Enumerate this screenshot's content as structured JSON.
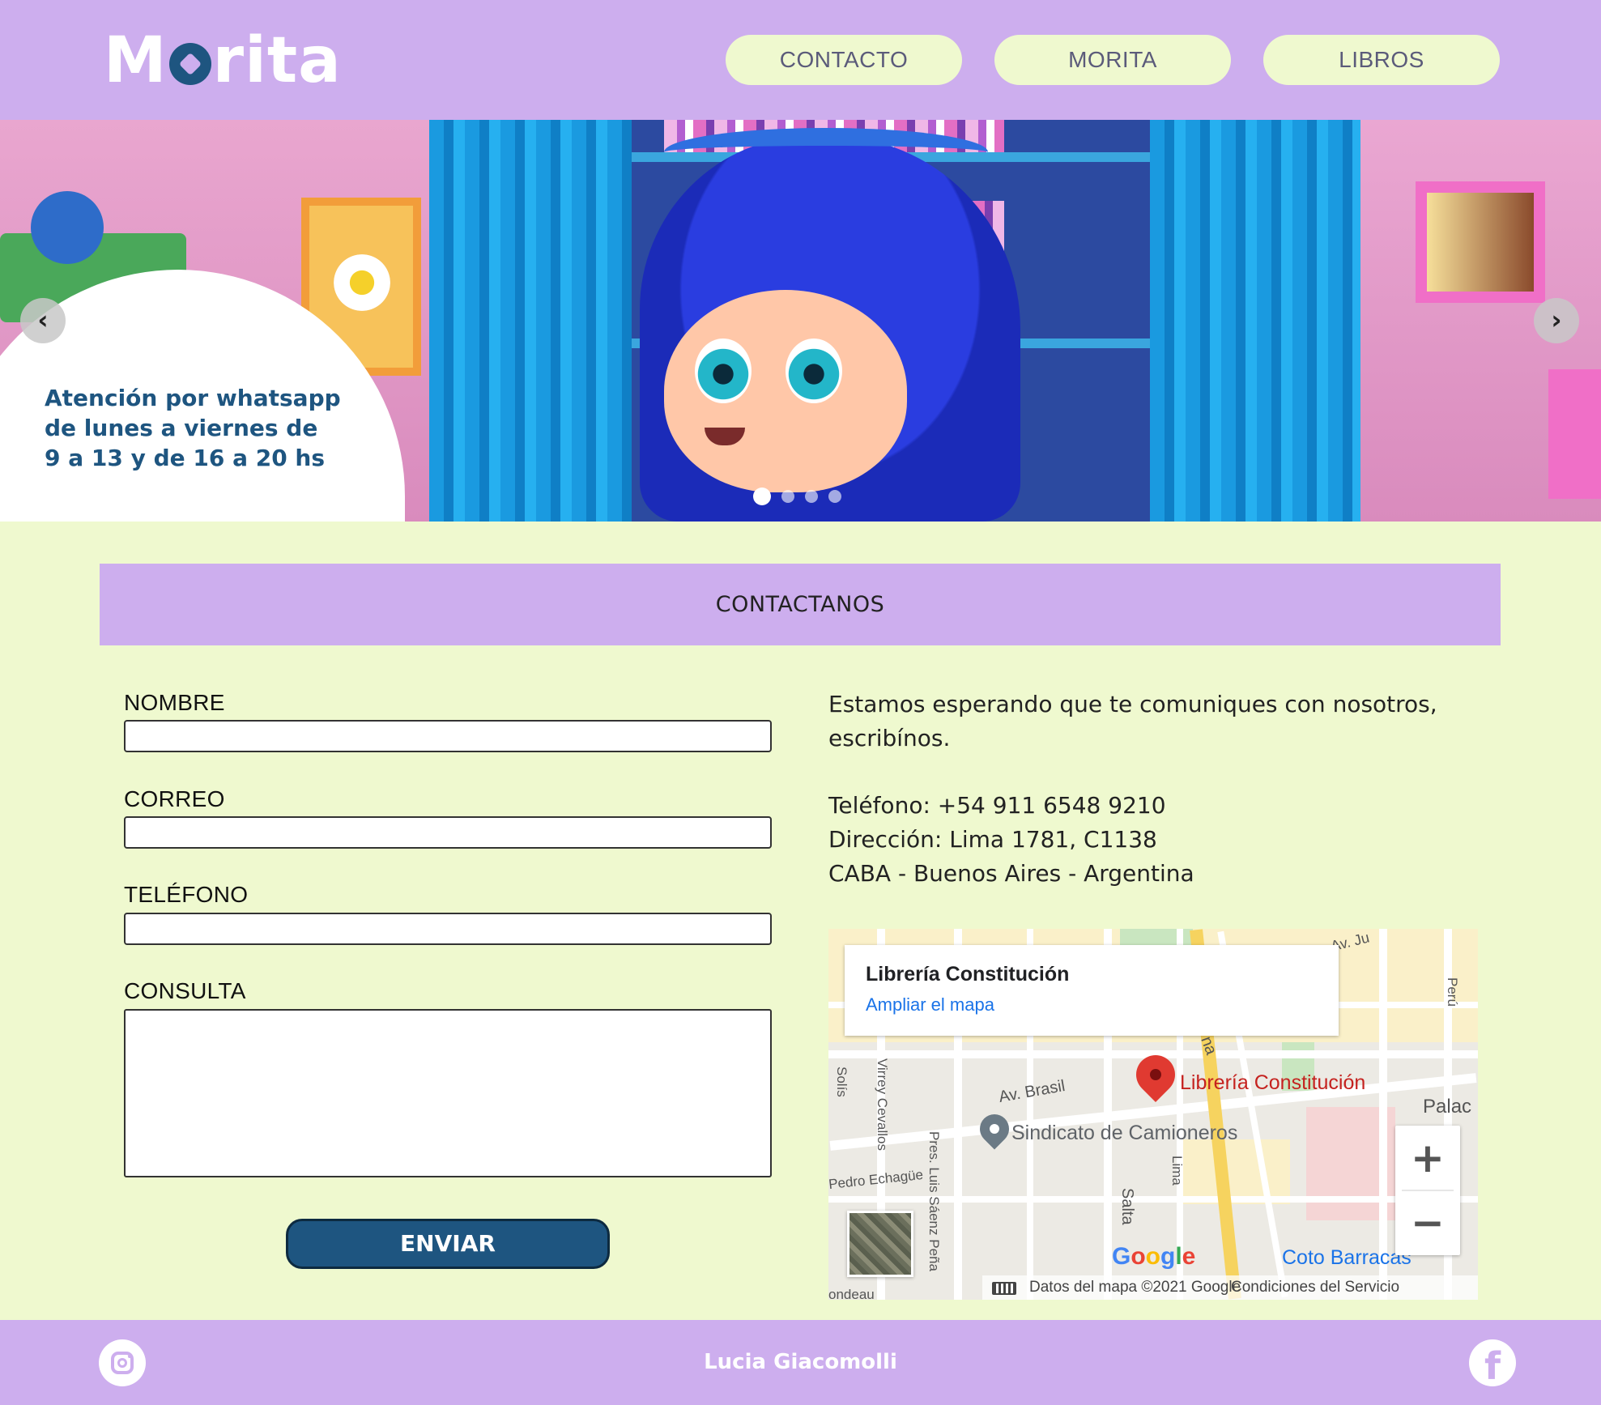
{
  "header": {
    "logo_text": "Morita",
    "nav": [
      "CONTACTO",
      "MORITA",
      "LIBROS"
    ]
  },
  "hero": {
    "bubble_lines": [
      "Atención por whatsapp",
      "de lunes a viernes de",
      "9 a 13 y de 16 a 20 hs"
    ],
    "prev_icon": "chevron-left-icon",
    "next_icon": "chevron-right-icon",
    "slide_count": 4,
    "active_slide": 1
  },
  "contact": {
    "title": "CONTACTANOS",
    "form": {
      "name_label": "NOMBRE",
      "email_label": "CORREO",
      "phone_label": "TELÉFONO",
      "query_label": "CONSULTA",
      "name_value": "",
      "email_value": "",
      "phone_value": "",
      "query_value": "",
      "submit_label": "ENVIAR"
    },
    "info": {
      "intro_line1": "Estamos esperando que te comuniques con nosotros,",
      "intro_line2": "escribínos.",
      "phone": "Teléfono: +54 911 6548 9210",
      "address": "Dirección: Lima 1781, C1138",
      "city": "CABA - Buenos Aires - Argentina"
    }
  },
  "map": {
    "place_title": "Librería Constitución",
    "enlarge_link": "Ampliar el mapa",
    "pin_label": "Librería Constitución",
    "secondary_pin_label": "Sindicato de Camioneros",
    "streets": {
      "brasil": "Av. Brasil",
      "solis": "Solís",
      "cevallos": "Virrey Cevallos",
      "saenz_pena": "Pres. Luis Sáenz Peña",
      "echague": "Pedro Echagüe",
      "salta": "Salta",
      "lima": "Lima",
      "peru": "Perú",
      "na": "na",
      "av_ju": "Av. Ju",
      "ondeau": "ondeau"
    },
    "palace_label": "Palac",
    "coto_label": "Coto Barracas",
    "google_logo": "Google",
    "attribution": "Datos del mapa ©2021 Google",
    "terms": "Condiciones del Servicio",
    "zoom_in": "+",
    "zoom_out": "−"
  },
  "footer": {
    "name": "Lucia Giacomolli",
    "instagram_icon": "instagram-icon",
    "facebook_icon": "facebook-icon"
  },
  "colors": {
    "lilac": "#cdaeee",
    "cream": "#eff9cf",
    "navy": "#1e5580"
  }
}
